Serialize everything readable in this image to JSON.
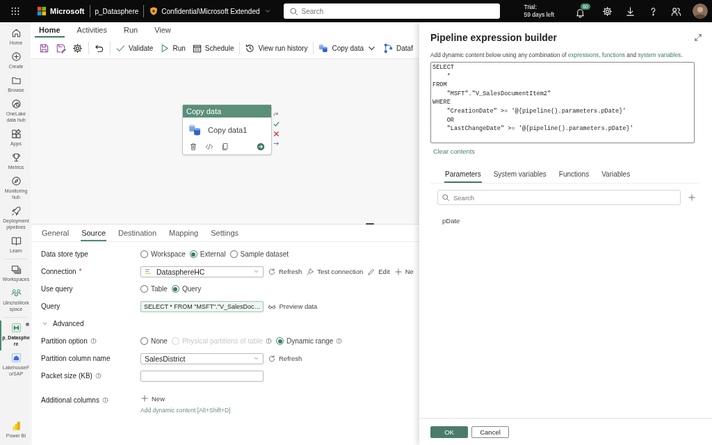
{
  "topbar": {
    "product": "Microsoft",
    "workspace": "p_Datasphere",
    "sensitivity": "Confidential\\Microsoft Extended",
    "search": {
      "placeholder": "Search"
    },
    "trial": [
      "Trial:",
      "59 days left"
    ],
    "notifications": "60"
  },
  "nav": {
    "groups": [
      [
        {
          "label": "Home",
          "selected": false,
          "unsaved": false
        },
        {
          "label": "Create",
          "selected": false,
          "unsaved": false
        },
        {
          "label": "Browse",
          "selected": false,
          "unsaved": false
        },
        {
          "label": "OneLake data hub",
          "selected": false,
          "unsaved": false
        },
        {
          "label": "Apps",
          "selected": false,
          "unsaved": false
        },
        {
          "label": "Metrics",
          "selected": false,
          "unsaved": false
        },
        {
          "label": "Monitoring hub",
          "selected": false,
          "unsaved": false
        },
        {
          "label": "Deployment pipelines",
          "selected": false,
          "unsaved": false
        },
        {
          "label": "Learn",
          "selected": false,
          "unsaved": false
        }
      ],
      [
        {
          "label": "Workspaces",
          "selected": false,
          "unsaved": false
        },
        {
          "label": "UlrichsWorkspace",
          "selected": false,
          "unsaved": false
        }
      ],
      [
        {
          "label": "p_Datasphere",
          "selected": true,
          "unsaved": true
        },
        {
          "label": "LakehouseForSAP",
          "selected": false,
          "unsaved": false
        }
      ]
    ],
    "footer": {
      "label": "Power BI"
    }
  },
  "ribbon": {
    "tabs": [
      {
        "label": "Home",
        "selected": true
      },
      {
        "label": "Activities",
        "selected": false
      },
      {
        "label": "Run",
        "selected": false
      },
      {
        "label": "View",
        "selected": false
      }
    ],
    "toolbar": [
      {
        "kind": "icon"
      },
      {
        "kind": "icon"
      },
      {
        "kind": "icon"
      },
      {
        "kind": "separator"
      },
      {
        "kind": "icon"
      },
      {
        "kind": "separator"
      },
      {
        "kind": "button",
        "label": "Validate"
      },
      {
        "kind": "button",
        "label": "Run"
      },
      {
        "kind": "button",
        "label": "Schedule"
      },
      {
        "kind": "separator"
      },
      {
        "kind": "button",
        "label": "View run history"
      },
      {
        "kind": "separator"
      },
      {
        "kind": "dropdown",
        "label": "Copy data"
      },
      {
        "kind": "button",
        "label": "Dataf"
      }
    ]
  },
  "canvas": {
    "node": {
      "title": "Copy data",
      "name": "Copy data1"
    }
  },
  "properties": {
    "tabs": [
      {
        "label": "General",
        "selected": false
      },
      {
        "label": "Source",
        "selected": true
      },
      {
        "label": "Destination",
        "selected": false
      },
      {
        "label": "Mapping",
        "selected": false
      },
      {
        "label": "Settings",
        "selected": false
      }
    ],
    "rows": [
      {
        "kind": "radio",
        "label": "Data store type",
        "options": [
          {
            "label": "Workspace",
            "selected": false,
            "disabled": false,
            "info": false
          },
          {
            "label": "External",
            "selected": true,
            "disabled": false,
            "info": false
          },
          {
            "label": "Sample dataset",
            "selected": false,
            "disabled": false,
            "info": false
          }
        ]
      },
      {
        "kind": "select",
        "label": "Connection",
        "required_mark": "*",
        "value": "DatasphereHC",
        "actions": [
          {
            "kind": "refresh",
            "label": "Refresh"
          },
          {
            "kind": "test",
            "label": "Test connection"
          },
          {
            "kind": "edit",
            "label": "Edit"
          },
          {
            "kind": "new",
            "label": "Ne"
          }
        ]
      },
      {
        "kind": "radio",
        "label": "Use query",
        "options": [
          {
            "label": "Table",
            "selected": false,
            "disabled": false,
            "info": false
          },
          {
            "label": "Query",
            "selected": true,
            "disabled": false,
            "info": false
          }
        ]
      },
      {
        "kind": "query",
        "label": "Query",
        "value": "SELECT * FROM \"MSFT\".\"V_SalesDoc…",
        "actions": [
          {
            "kind": "preview",
            "label": "Preview data"
          }
        ]
      },
      {
        "kind": "expander",
        "label": "Advanced",
        "expanded": true
      },
      {
        "kind": "radio",
        "label": "Partition option",
        "info": true,
        "options": [
          {
            "label": "None",
            "selected": false,
            "disabled": false,
            "info": false
          },
          {
            "label": "Physical partitions of table",
            "selected": false,
            "disabled": true,
            "info": true
          },
          {
            "label": "Dynamic range",
            "selected": true,
            "disabled": false,
            "info": true
          }
        ]
      },
      {
        "kind": "select",
        "label": "Partition column name",
        "value": "SalesDistrict",
        "actions": [
          {
            "kind": "refresh",
            "label": "Refresh"
          }
        ]
      },
      {
        "kind": "input",
        "label": "Packet size (KB)",
        "info": true
      },
      {
        "kind": "add",
        "label": "Additional columns",
        "info": true,
        "button": "New",
        "hint": "Add dynamic content [Alt+Shift+D]"
      }
    ]
  },
  "panel": {
    "title": "Pipeline expression builder",
    "description": [
      {
        "text": "Add dynamic content below using any combination of ",
        "link": false
      },
      {
        "text": "expressions, functions",
        "link": true
      },
      {
        "text": " and ",
        "link": false
      },
      {
        "text": "system variables",
        "link": true
      },
      {
        "text": ".",
        "link": false
      }
    ],
    "editor_lines": [
      "SELECT",
      "    *",
      "FROM",
      "    \"MSFT\".\"V_SalesDocumentItem2\"",
      "WHERE",
      "    \"CreationDate\" >= '@{pipeline().parameters.pDate}'",
      "    OR",
      "    \"LastChangeDate\" >= '@{pipeline().parameters.pDate}'"
    ],
    "clear": "Clear contents",
    "tabs": [
      {
        "label": "Parameters",
        "selected": true
      },
      {
        "label": "System variables",
        "selected": false
      },
      {
        "label": "Functions",
        "selected": false
      },
      {
        "label": "Variables",
        "selected": false
      }
    ],
    "search": {
      "placeholder": "Search"
    },
    "parameters": [
      "pDate"
    ],
    "buttons": [
      {
        "label": "OK",
        "kind": "primary"
      },
      {
        "label": "Cancel",
        "kind": "secondary"
      }
    ]
  }
}
